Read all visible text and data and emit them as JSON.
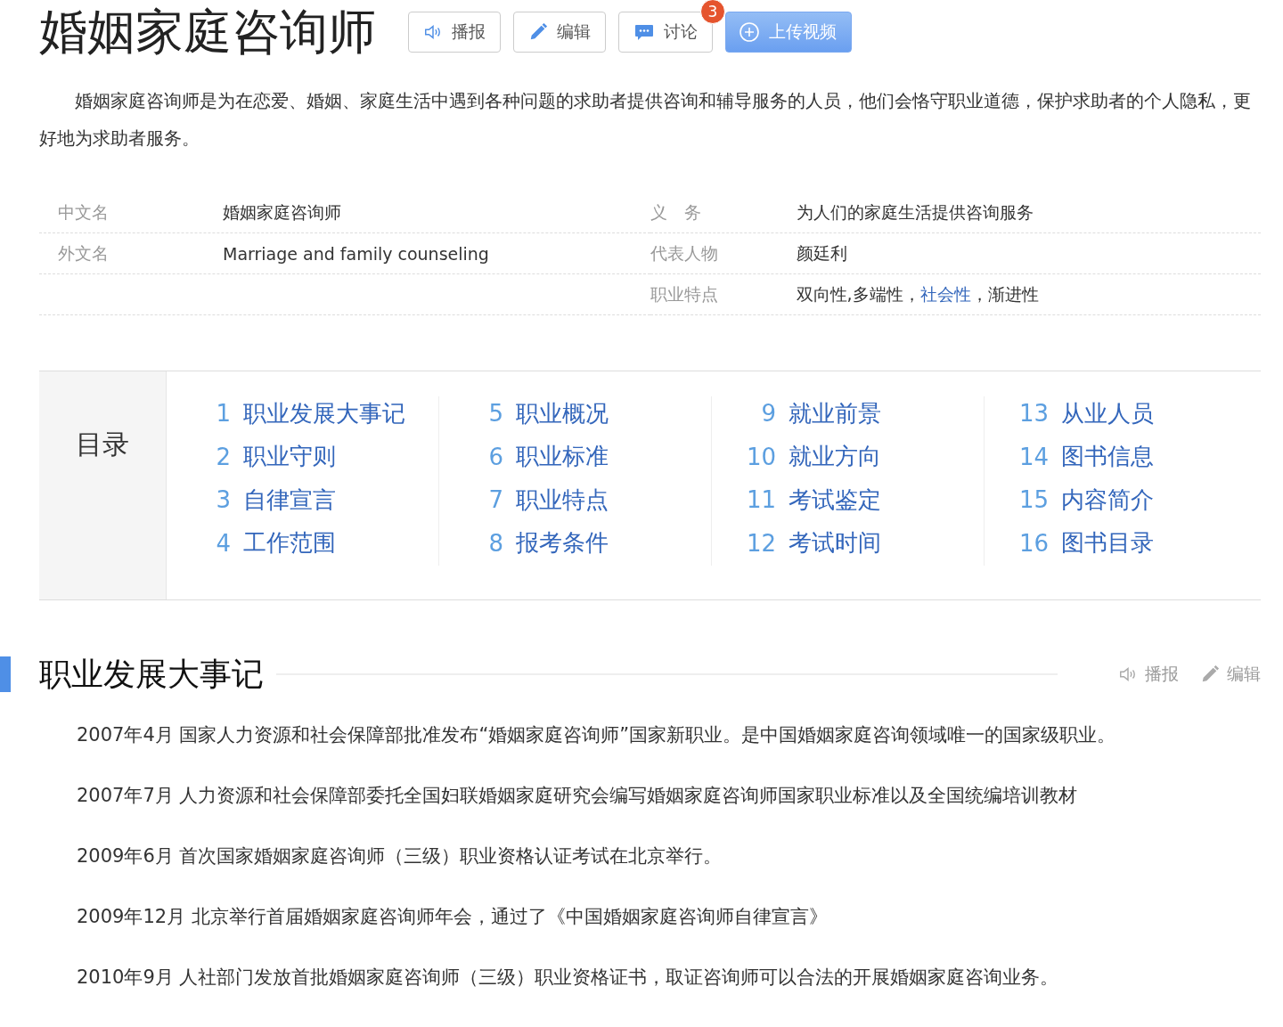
{
  "title": "婚姻家庭咨询师",
  "actions": [
    {
      "kind": "speaker",
      "label": "播报"
    },
    {
      "kind": "pencil",
      "label": "编辑"
    },
    {
      "kind": "chat",
      "label": "讨论",
      "badge": "3"
    },
    {
      "kind": "upload",
      "label": "上传视频"
    }
  ],
  "summary": "婚姻家庭咨询师是为在恋爱、婚姻、家庭生活中遇到各种问题的求助者提供咨询和辅导服务的人员，他们会恪守职业道德，保护求助者的个人隐私，更好地为求助者服务。",
  "info": {
    "left": [
      {
        "label": "中文名",
        "value": [
          {
            "text": "婚姻家庭咨询师"
          }
        ]
      },
      {
        "label": "外文名",
        "value": [
          {
            "text": "Marriage and family counseling"
          }
        ]
      }
    ],
    "right": [
      {
        "label": "义　务",
        "value": [
          {
            "text": "为人们的家庭生活提供咨询服务"
          }
        ]
      },
      {
        "label": "代表人物",
        "value": [
          {
            "text": "颜廷利"
          }
        ]
      },
      {
        "label": "职业特点",
        "value": [
          {
            "text": "双向性,多端性，"
          },
          {
            "text": "社会性",
            "link": true
          },
          {
            "text": "，渐进性"
          }
        ]
      }
    ]
  },
  "catalog": {
    "heading": "目录",
    "columns": [
      [
        {
          "num": "1",
          "title": "职业发展大事记"
        },
        {
          "num": "2",
          "title": "职业守则"
        },
        {
          "num": "3",
          "title": "自律宣言"
        },
        {
          "num": "4",
          "title": "工作范围"
        }
      ],
      [
        {
          "num": "5",
          "title": "职业概况"
        },
        {
          "num": "6",
          "title": "职业标准"
        },
        {
          "num": "7",
          "title": "职业特点"
        },
        {
          "num": "8",
          "title": "报考条件"
        }
      ],
      [
        {
          "num": "9",
          "title": "就业前景"
        },
        {
          "num": "10",
          "title": "就业方向"
        },
        {
          "num": "11",
          "title": "考试鉴定"
        },
        {
          "num": "12",
          "title": "考试时间"
        }
      ],
      [
        {
          "num": "13",
          "title": "从业人员"
        },
        {
          "num": "14",
          "title": "图书信息"
        },
        {
          "num": "15",
          "title": "内容简介"
        },
        {
          "num": "16",
          "title": "图书目录"
        }
      ]
    ]
  },
  "section": {
    "heading": "职业发展大事记",
    "actions": [
      {
        "kind": "speaker",
        "label": "播报"
      },
      {
        "kind": "pencil",
        "label": "编辑"
      }
    ],
    "paragraphs": [
      "2007年4月 国家人力资源和社会保障部批准发布“婚姻家庭咨询师”国家新职业。是中国婚姻家庭咨询领域唯一的国家级职业。",
      "2007年7月 人力资源和社会保障部委托全国妇联婚姻家庭研究会编写婚姻家庭咨询师国家职业标准以及全国统编培训教材",
      "2009年6月 首次国家婚姻家庭咨询师（三级）职业资格认证考试在北京举行。",
      "2009年12月 北京举行首届婚姻家庭咨询师年会，通过了《中国婚姻家庭咨询师自律宣言》",
      "2010年9月 人社部门发放首批婚姻家庭咨询师（三级）职业资格证书，取证咨询师可以合法的开展婚姻家庭咨询业务。"
    ]
  }
}
